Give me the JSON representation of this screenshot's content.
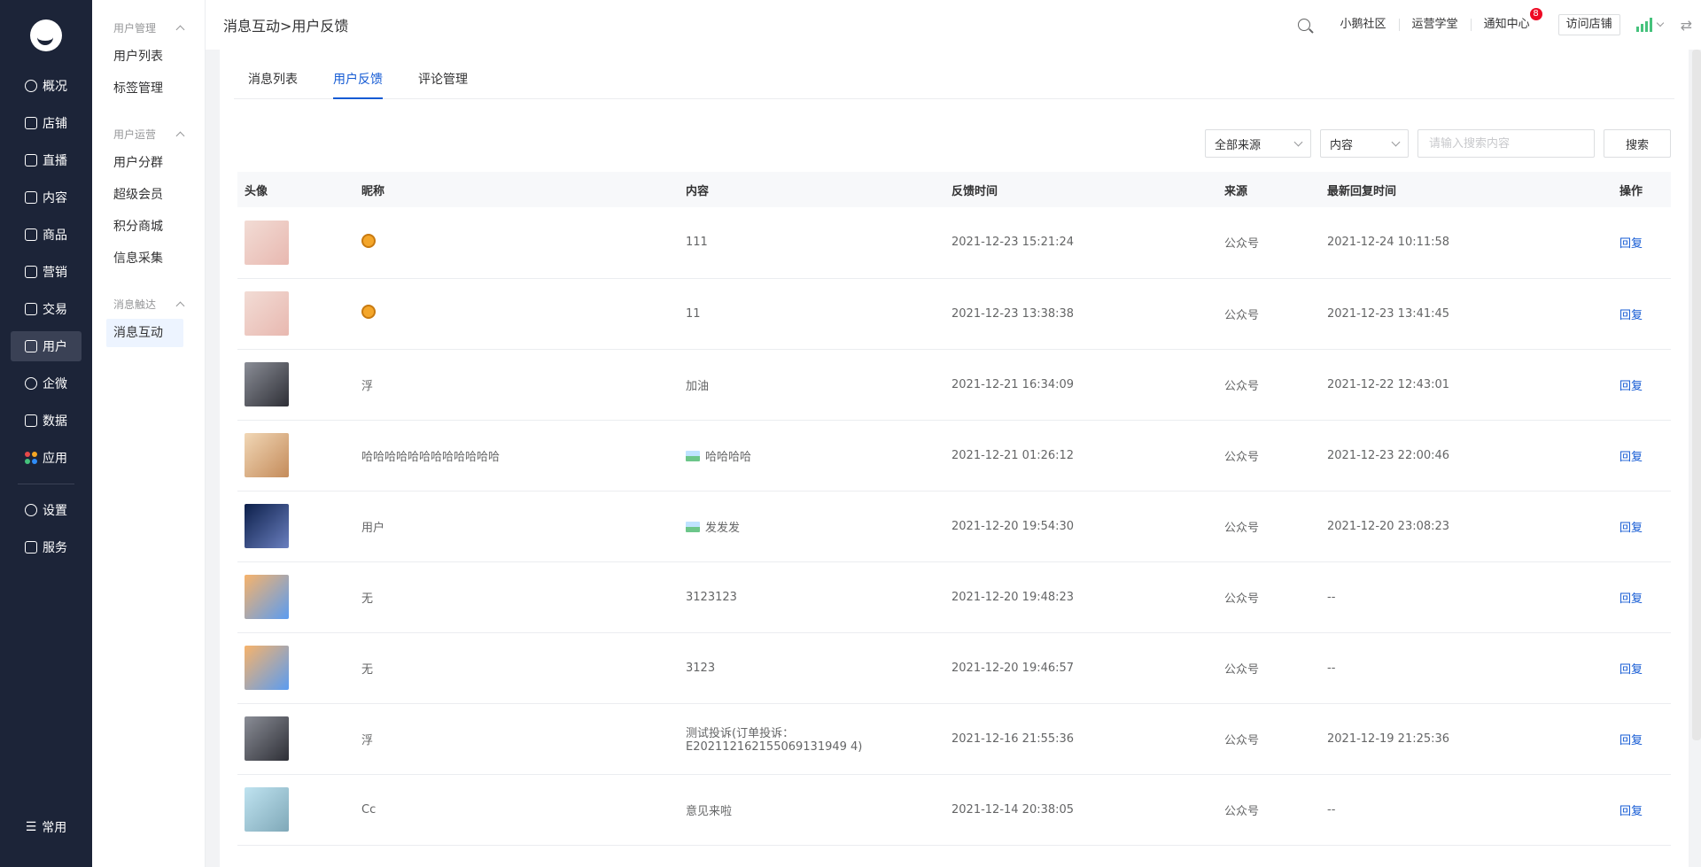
{
  "nav": {
    "items": [
      {
        "label": "概况",
        "icon": "dashboard-icon"
      },
      {
        "label": "店铺",
        "icon": "shop-icon"
      },
      {
        "label": "直播",
        "icon": "live-icon"
      },
      {
        "label": "内容",
        "icon": "content-icon"
      },
      {
        "label": "商品",
        "icon": "goods-icon"
      },
      {
        "label": "营销",
        "icon": "marketing-icon"
      },
      {
        "label": "交易",
        "icon": "trade-icon"
      },
      {
        "label": "用户",
        "icon": "user-icon"
      },
      {
        "label": "企微",
        "icon": "wecom-icon"
      },
      {
        "label": "数据",
        "icon": "data-icon"
      },
      {
        "label": "应用",
        "icon": "apps-icon"
      }
    ],
    "settings": "设置",
    "service": "服务",
    "common": "常用"
  },
  "submenu": {
    "group1": "用户管理",
    "user_list": "用户列表",
    "tag_manage": "标签管理",
    "group2": "用户运营",
    "user_segment": "用户分群",
    "super_member": "超级会员",
    "points_mall": "积分商城",
    "info_collect": "信息采集",
    "group3": "消息触达",
    "message_interact": "消息互动"
  },
  "header": {
    "breadcrumb": "消息互动>用户反馈",
    "community": "小鹅社区",
    "academy": "运营学堂",
    "notice": "通知中心",
    "notice_count": "8",
    "visit_shop": "访问店铺"
  },
  "tabs": [
    "消息列表",
    "用户反馈",
    "评论管理"
  ],
  "filters": {
    "source": "全部来源",
    "field": "内容",
    "search_placeholder": "请输入搜索内容",
    "search_btn": "搜索"
  },
  "table": {
    "headers": [
      "头像",
      "昵称",
      "内容",
      "反馈时间",
      "来源",
      "最新回复时间",
      "操作"
    ],
    "rows": [
      {
        "nickname": "",
        "content": "111",
        "has_image": false,
        "time": "2021-12-23 15:21:24",
        "source": "公众号",
        "reply_time": "2021-12-24 10:11:58",
        "action": "回复"
      },
      {
        "nickname": "",
        "content": "11",
        "has_image": false,
        "time": "2021-12-23 13:38:38",
        "source": "公众号",
        "reply_time": "2021-12-23 13:41:45",
        "action": "回复"
      },
      {
        "nickname": "浮",
        "content": "加油",
        "has_image": false,
        "time": "2021-12-21 16:34:09",
        "source": "公众号",
        "reply_time": "2021-12-22 12:43:01",
        "action": "回复"
      },
      {
        "nickname": "哈哈哈哈哈哈哈哈哈哈哈哈",
        "content": "哈哈哈哈",
        "has_image": true,
        "time": "2021-12-21 01:26:12",
        "source": "公众号",
        "reply_time": "2021-12-23 22:00:46",
        "action": "回复"
      },
      {
        "nickname": "用户",
        "content": "发发发",
        "has_image": true,
        "time": "2021-12-20 19:54:30",
        "source": "公众号",
        "reply_time": "2021-12-20 23:08:23",
        "action": "回复"
      },
      {
        "nickname": "无",
        "content": "3123123",
        "has_image": false,
        "time": "2021-12-20 19:48:23",
        "source": "公众号",
        "reply_time": "--",
        "action": "回复"
      },
      {
        "nickname": "无",
        "content": "3123",
        "has_image": false,
        "time": "2021-12-20 19:46:57",
        "source": "公众号",
        "reply_time": "--",
        "action": "回复"
      },
      {
        "nickname": "浮",
        "content": "测试投诉(订单投诉：\nE202112162155069131949 4)",
        "has_image": false,
        "time": "2021-12-16 21:55:36",
        "source": "公众号",
        "reply_time": "2021-12-19 21:25:36",
        "action": "回复"
      },
      {
        "nickname": "Cc",
        "content": "意见来啦",
        "has_image": false,
        "time": "2021-12-14 20:38:05",
        "source": "公众号",
        "reply_time": "--",
        "action": "回复"
      }
    ]
  },
  "colors": {
    "nav_bg": "#1c2438",
    "accent": "#155bd4",
    "signal": "#45c27c",
    "badge": "#ee0a24"
  }
}
